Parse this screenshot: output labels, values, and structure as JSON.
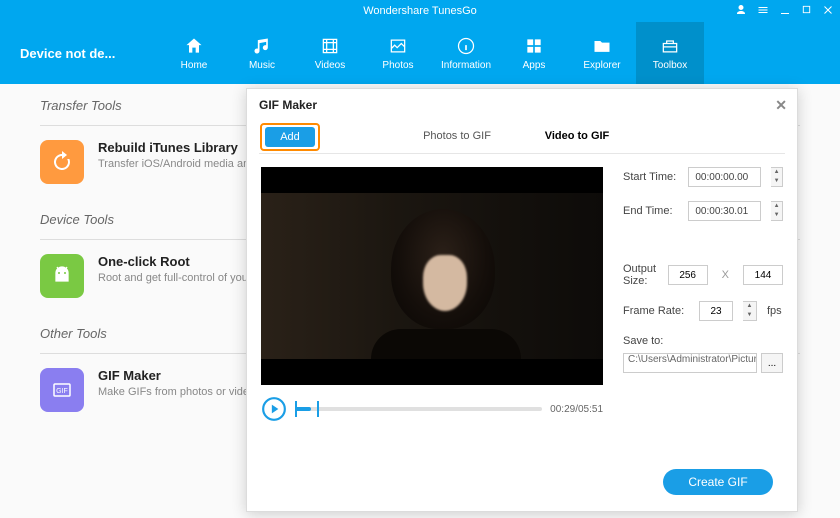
{
  "app": {
    "title": "Wondershare TunesGo"
  },
  "device_status": "Device not de...",
  "nav": [
    {
      "label": "Home",
      "icon": "home"
    },
    {
      "label": "Music",
      "icon": "music"
    },
    {
      "label": "Videos",
      "icon": "videos"
    },
    {
      "label": "Photos",
      "icon": "photos"
    },
    {
      "label": "Information",
      "icon": "info"
    },
    {
      "label": "Apps",
      "icon": "apps"
    },
    {
      "label": "Explorer",
      "icon": "explorer"
    },
    {
      "label": "Toolbox",
      "icon": "toolbox"
    }
  ],
  "sections": {
    "transfer_tools": "Transfer Tools",
    "device_tools": "Device Tools",
    "other_tools": "Other Tools"
  },
  "tools": {
    "rebuild": {
      "title": "Rebuild iTunes Library",
      "desc": "Transfer iOS/Android media and Playlists to iTunes"
    },
    "root": {
      "title": "One-click Root",
      "desc": "Root and get full-control of your Android devices."
    },
    "gif": {
      "title": "GIF Maker",
      "desc": "Make GIFs from photos or video"
    }
  },
  "modal": {
    "title": "GIF Maker",
    "add_label": "Add",
    "tabs": {
      "photos": "Photos to GIF",
      "video": "Video to GIF"
    },
    "start_time_label": "Start Time:",
    "start_time_value": "00:00:00.00",
    "end_time_label": "End Time:",
    "end_time_value": "00:00:30.01",
    "output_size_label": "Output Size:",
    "output_w": "256",
    "output_h": "144",
    "frame_rate_label": "Frame Rate:",
    "frame_rate_value": "23",
    "fps_suffix": "fps",
    "save_to_label": "Save to:",
    "save_path": "C:\\Users\\Administrator\\Pictures\\W",
    "browse": "...",
    "time_display": "00:29/05:51",
    "create_btn": "Create GIF",
    "x_sep": "X"
  }
}
